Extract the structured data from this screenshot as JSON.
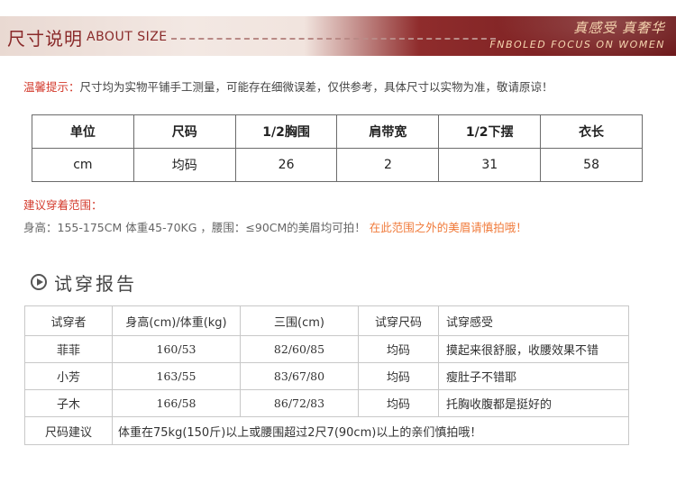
{
  "banner": {
    "title_cn": "尺寸说明",
    "title_en": "ABOUT SIZE",
    "slogan_cn": "真感受 真奢华",
    "slogan_en": "FNBOLED FOCUS ON WOMEN"
  },
  "tip": {
    "label": "温馨提示：",
    "text": "尺寸均为实物平铺手工测量，可能存在细微误差，仅供参考，具体尺寸以实物为准，敬请原谅！"
  },
  "size_table": {
    "headers": [
      "单位",
      "尺码",
      "1/2胸围",
      "肩带宽",
      "1/2下摆",
      "衣长"
    ],
    "row": [
      "cm",
      "均码",
      "26",
      "2",
      "31",
      "58"
    ]
  },
  "recommend": {
    "title": "建议穿着范围：",
    "body": "身高：155-175CM 体重45-70KG ，腰围：≤90CM的美眉均可拍！",
    "warning": "在此范围之外的美眉请慎拍哦！"
  },
  "trial": {
    "title": "试穿报告",
    "headers": [
      "试穿者",
      "身高(cm)/体重(kg)",
      "三围(cm)",
      "试穿尺码",
      "试穿感受"
    ],
    "rows": [
      [
        "菲菲",
        "160/53",
        "82/60/85",
        "均码",
        "摸起来很舒服，收腰效果不错"
      ],
      [
        "小芳",
        "163/55",
        "83/67/80",
        "均码",
        "瘦肚子不错耶"
      ],
      [
        "子木",
        "166/58",
        "86/72/83",
        "均码",
        "托胸收腹都是挺好的"
      ]
    ],
    "note_label": "尺码建议",
    "note_text": "体重在75kg(150斤)以上或腰围超过2尺7(90cm)以上的亲们慎拍哦！"
  }
}
